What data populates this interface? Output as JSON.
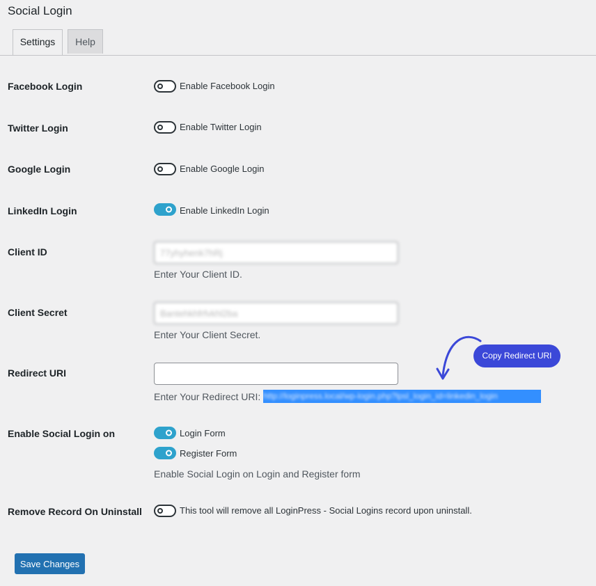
{
  "page": {
    "title": "Social Login"
  },
  "tabs": [
    {
      "label": "Settings",
      "active": true
    },
    {
      "label": "Help",
      "active": false
    }
  ],
  "fields": {
    "facebook": {
      "label": "Facebook Login",
      "toggle_label": "Enable Facebook Login",
      "enabled": false
    },
    "twitter": {
      "label": "Twitter Login",
      "toggle_label": "Enable Twitter Login",
      "enabled": false
    },
    "google": {
      "label": "Google Login",
      "toggle_label": "Enable Google Login",
      "enabled": false
    },
    "linkedin": {
      "label": "LinkedIn Login",
      "toggle_label": "Enable LinkedIn Login",
      "enabled": true
    },
    "client_id": {
      "label": "Client ID",
      "value": "77yhyhenk7hRj",
      "description": "Enter Your Client ID."
    },
    "client_secret": {
      "label": "Client Secret",
      "value": "Bantehkhfrfvkhl2ba",
      "description": "Enter Your Client Secret."
    },
    "redirect_uri": {
      "label": "Redirect URI",
      "value": "",
      "description_prefix": "Enter Your Redirect URI: ",
      "uri": "http://loginpress.local/wp-login.php?lpsl_login_id=linkedin_login"
    },
    "enable_on": {
      "label": "Enable Social Login on",
      "options": [
        {
          "label": "Login Form",
          "enabled": true
        },
        {
          "label": "Register Form",
          "enabled": true
        }
      ],
      "description": "Enable Social Login on Login and Register form"
    },
    "remove_record": {
      "label": "Remove Record On Uninstall",
      "toggle_label": "This tool will remove all LoginPress - Social Logins record upon uninstall.",
      "enabled": false
    }
  },
  "callout": {
    "label": "Copy Redirect URI",
    "color": "#3b48d8"
  },
  "save_button": {
    "label": "Save Changes",
    "color": "#2271b1"
  },
  "colors": {
    "toggle_on": "#2ea2cc",
    "background": "#f0f0f1"
  }
}
